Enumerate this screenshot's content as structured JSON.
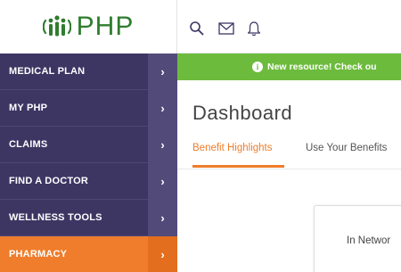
{
  "logo": {
    "text": "PHP"
  },
  "sidebar": {
    "items": [
      {
        "label": "MEDICAL PLAN",
        "chevron": "›",
        "active": false
      },
      {
        "label": "MY PHP",
        "chevron": "›",
        "active": false
      },
      {
        "label": "CLAIMS",
        "chevron": "›",
        "active": false
      },
      {
        "label": "FIND A DOCTOR",
        "chevron": "›",
        "active": false
      },
      {
        "label": "WELLNESS TOOLS",
        "chevron": "›",
        "active": false
      },
      {
        "label": "PHARMACY",
        "chevron": "›",
        "active": true
      }
    ]
  },
  "toolbar": {
    "icons": [
      "search-icon",
      "mail-icon",
      "bell-icon"
    ]
  },
  "banner": {
    "icon": "info-icon",
    "glyph": "i",
    "text": "New resource! Check ou"
  },
  "main": {
    "title": "Dashboard",
    "tabs": [
      {
        "label": "Benefit Highlights",
        "active": true
      },
      {
        "label": "Use Your Benefits",
        "active": false
      }
    ],
    "card": {
      "label": "In Networ"
    }
  },
  "colors": {
    "sidebar": "#3d3663",
    "accent": "#ef7d2b",
    "banner": "#6cbb3c",
    "logo": "#2f7d2f"
  }
}
